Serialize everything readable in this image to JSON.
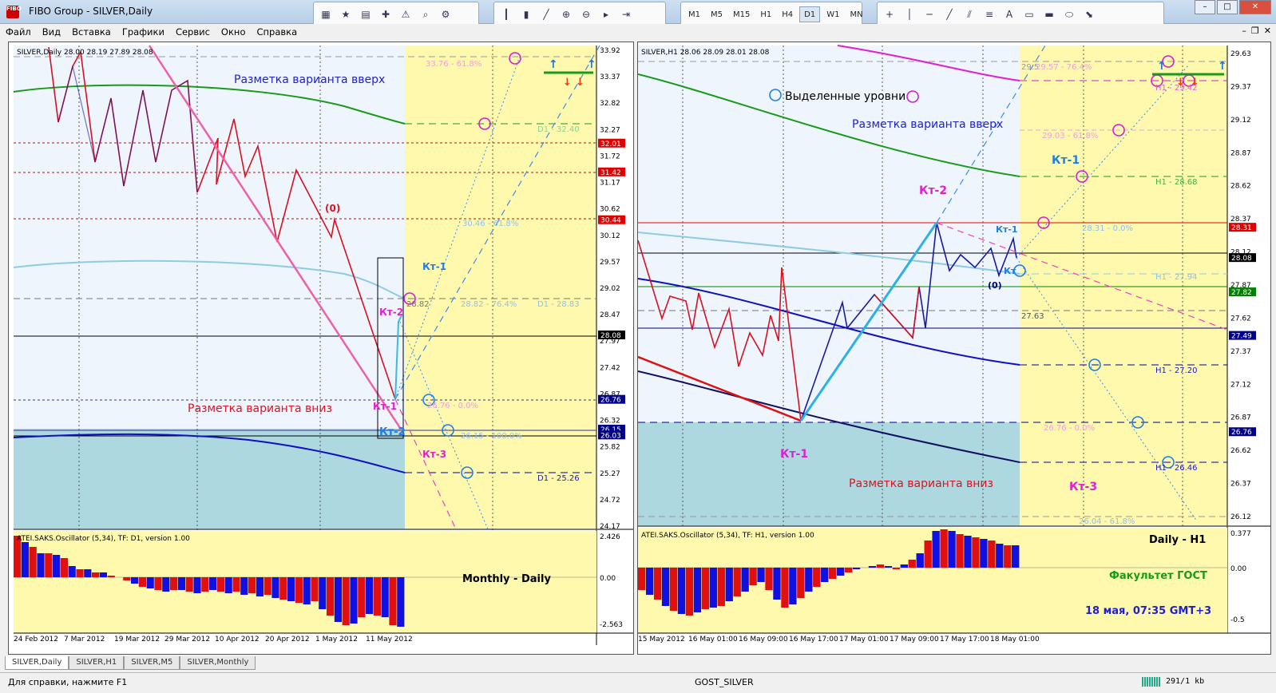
{
  "window": {
    "title": "FIBO Group - SILVER,Daily",
    "icon_text": "FIBO"
  },
  "menu": [
    "Файл",
    "Вид",
    "Вставка",
    "Графики",
    "Сервис",
    "Окно",
    "Справка"
  ],
  "timeframes": [
    "M1",
    "M5",
    "M15",
    "H1",
    "H4",
    "D1",
    "W1",
    "MN"
  ],
  "selected_timeframe": "D1",
  "left_chart": {
    "header": "SILVER,Daily  28.00 28.19 27.89 28.08",
    "price_labels": [
      "33.92",
      "33.37",
      "32.82",
      "32.27",
      "31.72",
      "31.17",
      "30.62",
      "30.12",
      "29.57",
      "29.02",
      "28.47",
      "27.97",
      "27.42",
      "26.87",
      "26.32",
      "25.82",
      "25.27",
      "24.72",
      "24.17"
    ],
    "price_highlights": [
      {
        "text": "32.01",
        "color": "#e00000"
      },
      {
        "text": "31.42",
        "color": "#e00000"
      },
      {
        "text": "30.44",
        "color": "#e00000"
      },
      {
        "text": "28.08",
        "color": "#000000"
      },
      {
        "text": "26.76",
        "color": "#00008b"
      },
      {
        "text": "26.15",
        "color": "#00008b"
      },
      {
        "text": "26.03",
        "color": "#00008b"
      }
    ],
    "date_labels": [
      "24 Feb 2012",
      "7 Mar 2012",
      "19 Mar 2012",
      "29 Mar 2012",
      "10 Apr 2012",
      "20 Apr 2012",
      "1 May 2012",
      "11 May 2012"
    ],
    "annotations": {
      "up_variant": "Разметка варианта вверх",
      "down_variant": "Разметка варианта вниз",
      "zero": "(0)",
      "kt1_blue": "Кт-1",
      "kt2_magenta": "Кт-2",
      "kt1_magenta": "Кт-1",
      "kt2_blue": "Кт-2",
      "kt3_magenta": "Кт-3",
      "lvl_3376": "33.76 - 61.8%",
      "lvl_d1_3240": "D1 - 32.40",
      "lvl_3046": "30.46 - 61.8%",
      "lvl_2882": "28.82",
      "lvl_2882_764": "28.82 - 76.4%",
      "lvl_d1_2883": "D1 - 28.83",
      "lvl_2676": "26.76 - 0.0%",
      "lvl_2615": "26.15 - 100.0%",
      "lvl_d1_2526": "D1 - 25.26"
    },
    "oscillator": {
      "header": "ATEI.SAKS.Oscillator (5,34), TF: D1, version 1.00",
      "scale": [
        "2.426",
        "0.00",
        "-2.563"
      ],
      "caption": "Monthly - Daily"
    }
  },
  "right_chart": {
    "header": "SILVER,H1  28.06 28.09 28.01 28.08",
    "price_labels": [
      "29.63",
      "29.37",
      "29.12",
      "28.87",
      "28.62",
      "28.37",
      "28.12",
      "27.87",
      "27.62",
      "27.37",
      "27.12",
      "26.87",
      "26.62",
      "26.37",
      "26.12"
    ],
    "price_highlights": [
      {
        "text": "28.31",
        "color": "#e00000"
      },
      {
        "text": "28.08",
        "color": "#000000"
      },
      {
        "text": "27.82",
        "color": "#008000"
      },
      {
        "text": "27.49",
        "color": "#00008b"
      },
      {
        "text": "26.76",
        "color": "#00008b"
      }
    ],
    "date_labels": [
      "15 May 2012",
      "16 May 01:00",
      "16 May 09:00",
      "16 May 17:00",
      "17 May 01:00",
      "17 May 09:00",
      "17 May 17:00",
      "18 May 01:00"
    ],
    "annotations": {
      "legend_circles": "Выделенные уровни",
      "up_variant": "Разметка варианта вверх",
      "down_variant": "Разметка варианта вниз",
      "kt1_blue": "Кт-1",
      "kt2_magenta": "Кт-2",
      "kt1_small": "Кт-1",
      "kt_small2": "Кт",
      "zero": "(0)",
      "kt1_magenta": "Кт-1",
      "kt3_magenta": "Кт-3",
      "lvl_2957": "29.57 - 76.4%",
      "lvl_295": "29.5",
      "lvl_h1_2942": "H1 - 29.42",
      "lvl_2903": "29.03 - 61.8%",
      "lvl_h1_2868": "H1 - 28.68",
      "lvl_2831": "28.31 - 0.0%",
      "lvl_h1_2794": "H1 - 27.94",
      "lvl_2763": "27.63",
      "lvl_h1_2720": "H1 - 27.20",
      "lvl_2676": "26.76 - 0.0%",
      "lvl_h1_2646": "H1 - 26.46",
      "lvl_2604": "26.04 - 61.8%"
    },
    "oscillator": {
      "header": "ATEI.SAKS.Oscillator (5,34), TF: H1, version 1.00",
      "scale": [
        "0.377",
        "0.00",
        "-0.5"
      ],
      "caption1": "Daily - H1",
      "caption2": "Факультет ГОСТ",
      "caption3": "18 мая, 07:35  GMT+3"
    }
  },
  "tabs": [
    "SILVER,Daily",
    "SILVER,H1",
    "SILVER,M5",
    "SILVER,Monthly"
  ],
  "status": {
    "help": "Для справки, нажмите F1",
    "profile": "GOST_SILVER",
    "traffic": "291/1 kb"
  }
}
